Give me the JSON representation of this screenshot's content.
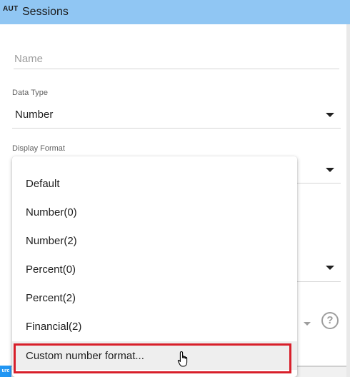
{
  "header": {
    "tag": "AUT",
    "title": "Sessions"
  },
  "form": {
    "name_placeholder": "Name",
    "data_type_label": "Data Type",
    "data_type_value": "Number",
    "display_format_label": "Display Format"
  },
  "menu": {
    "items": [
      {
        "label": "Default"
      },
      {
        "label": "Number(0)"
      },
      {
        "label": "Number(2)"
      },
      {
        "label": "Percent(0)"
      },
      {
        "label": "Percent(2)"
      },
      {
        "label": "Financial(2)"
      },
      {
        "label": "Custom number format..."
      }
    ],
    "highlighted_index": 6
  },
  "help_icon": {
    "glyph": "?"
  },
  "corner_badge": {
    "text": "urc"
  },
  "colors": {
    "header_bg": "#90c6f3",
    "highlight_box": "#d81f2a"
  }
}
